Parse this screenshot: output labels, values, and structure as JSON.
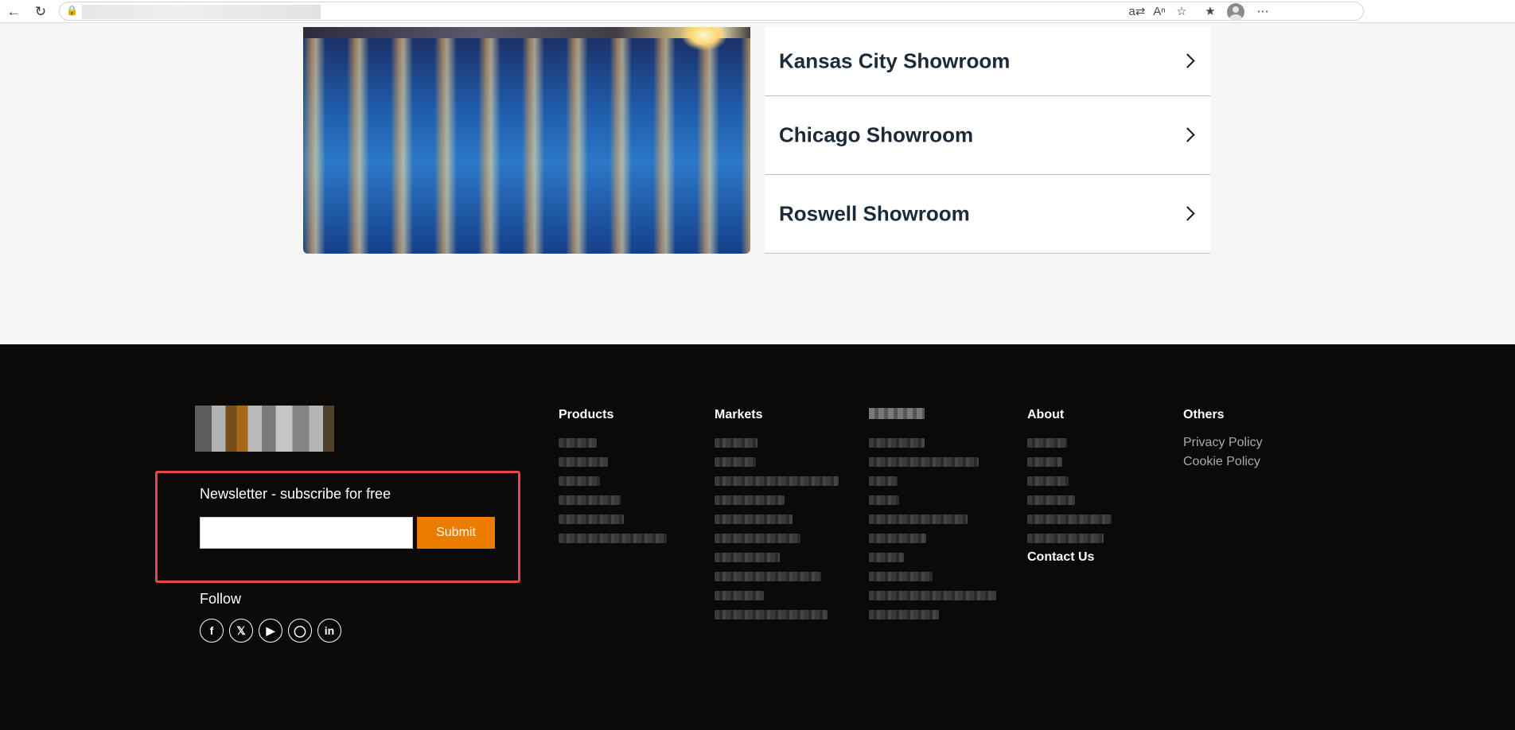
{
  "showrooms": [
    {
      "name": "Kansas City Showroom"
    },
    {
      "name": "Chicago Showroom"
    },
    {
      "name": "Roswell Showroom"
    }
  ],
  "newsletter": {
    "title": "Newsletter - subscribe for free",
    "input_value": "",
    "submit_label": "Submit"
  },
  "follow": {
    "label": "Follow",
    "networks": [
      "facebook",
      "x",
      "youtube",
      "instagram",
      "linkedin"
    ]
  },
  "columns": {
    "products": {
      "heading": "Products",
      "item_count": 6
    },
    "markets": {
      "heading": "Markets",
      "item_count": 10
    },
    "resources": {
      "heading": "",
      "item_count": 10
    },
    "about": {
      "heading": "About",
      "item_count": 6,
      "contact": "Contact Us"
    },
    "others": {
      "heading": "Others",
      "items": [
        "Privacy Policy",
        "Cookie Policy"
      ]
    }
  },
  "colors": {
    "accent": "#ec7c00",
    "highlight_border": "#e8444a",
    "footer_bg": "#0b0a09",
    "heading_text": "#1d2a3a"
  }
}
